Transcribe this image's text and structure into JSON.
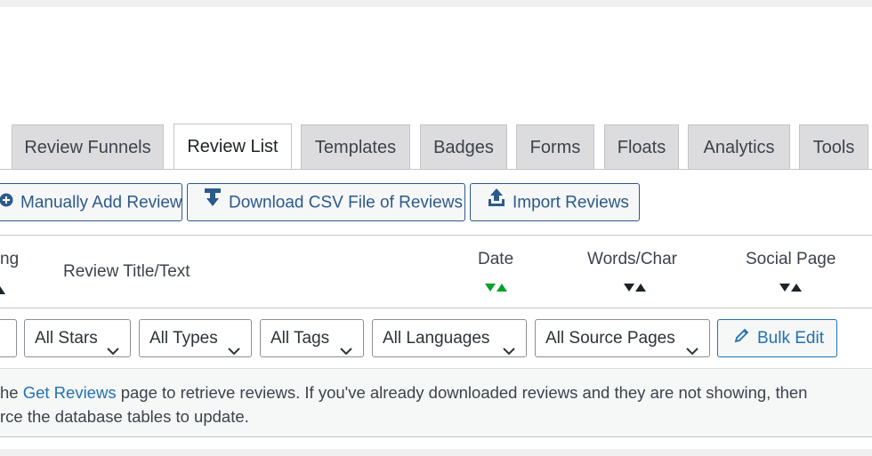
{
  "tabs": [
    {
      "label": "Review Funnels"
    },
    {
      "label": "Review List",
      "active": true
    },
    {
      "label": "Templates"
    },
    {
      "label": "Badges"
    },
    {
      "label": "Forms"
    },
    {
      "label": "Floats"
    },
    {
      "label": "Analytics"
    },
    {
      "label": "Tools"
    }
  ],
  "actions": {
    "manual_add": "Manually Add Review",
    "download_csv": "Download CSV File of Reviews",
    "import": "Import Reviews"
  },
  "columns": {
    "rating_partial": "ng",
    "title_text": "Review Title/Text",
    "date": "Date",
    "words_char": "Words/Char",
    "social_page": "Social Page"
  },
  "filters": {
    "stars": "All Stars",
    "types": "All Types",
    "tags": "All Tags",
    "languages": "All Languages",
    "source_pages": "All Source Pages",
    "bulk_edit": "Bulk Edit"
  },
  "notice": {
    "pre": "he ",
    "link": "Get Reviews",
    "post": " page to retrieve reviews. If you've already downloaded reviews and they are not showing, then",
    "line2": "rce the database tables to update."
  },
  "colors": {
    "primary": "#2271b1",
    "sort_active": "#00a32a",
    "sort_inactive": "#1d2327"
  }
}
